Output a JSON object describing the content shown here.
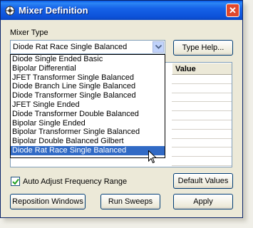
{
  "window": {
    "title": "Mixer Definition",
    "close": "✕"
  },
  "mixer_type": {
    "label": "Mixer Type",
    "selected": "Diode Rat Race Single Balanced",
    "options": [
      "Diode Single Ended Basic",
      "Bipolar Differential",
      "JFET Transformer Single Balanced",
      "Diode Branch Line Single Balanced",
      "Diode Transformer Single Balanced",
      "JFET Single Ended",
      "Diode Transformer Double Balanced",
      "Bipolar Single Ended",
      "Bipolar Transformer Single Balanced",
      "Bipolar Double Balanced Gilbert",
      "Diode Rat Race Single Balanced"
    ]
  },
  "buttons": {
    "type_help": "Type Help...",
    "default_values": "Default Values",
    "reposition": "Reposition Windows",
    "run_sweeps": "Run Sweeps",
    "apply": "Apply"
  },
  "grid": {
    "value_header": "Value"
  },
  "auto_adjust": {
    "label": "Auto Adjust Frequency Range",
    "checked": true
  }
}
